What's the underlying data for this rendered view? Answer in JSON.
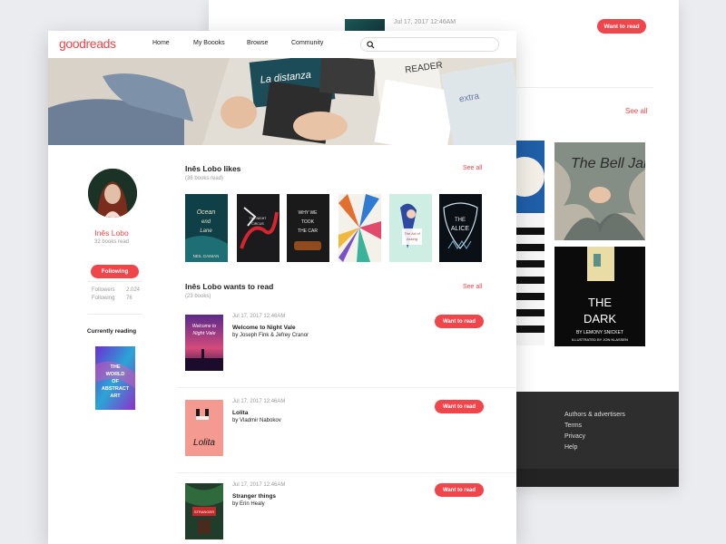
{
  "colors": {
    "accent": "#f0454a",
    "background": "#ebecef",
    "footer": "#2e2e2e"
  },
  "back_page": {
    "top_row": {
      "date": "Jul 17, 2017 12:46AM",
      "button": "Want to read"
    },
    "see_all": "See all",
    "footer_links": [
      "Authors & advertisers",
      "Terms",
      "Privacy",
      "Help"
    ]
  },
  "nav": {
    "logo": "goodreads",
    "links": [
      "Home",
      "My Boooks",
      "Browse",
      "Community"
    ],
    "search_placeholder": ""
  },
  "profile": {
    "name": "Inês Lobo",
    "books_read": "32 books read",
    "follow_button": "Following",
    "followers_label": "Followers",
    "followers_value": "2.024",
    "following_label": "Following",
    "following_value": "76",
    "currently_reading_label": "Currently reading"
  },
  "likes": {
    "title": "Inês Lobo likes",
    "subtitle": "(36 books read)",
    "see_all": "See all"
  },
  "wants": {
    "title": "Inês Lobo wants to read",
    "subtitle": "(23 books)",
    "see_all": "See all",
    "items": [
      {
        "date": "Jul 17, 2017 12:46AM",
        "title": "Welcome to Night Vale",
        "author": "by Joseph Fink & Jefrey Cranor",
        "button": "Want to read"
      },
      {
        "date": "Jul 17, 2017 12:46AM",
        "title": "Lolita",
        "author": "by Vladmir Nabokov",
        "button": "Want to read"
      },
      {
        "date": "Jul 17, 2017 12:46AM",
        "title": "Stranger things",
        "author": "by Erin Healy",
        "button": "Want to read"
      }
    ]
  }
}
